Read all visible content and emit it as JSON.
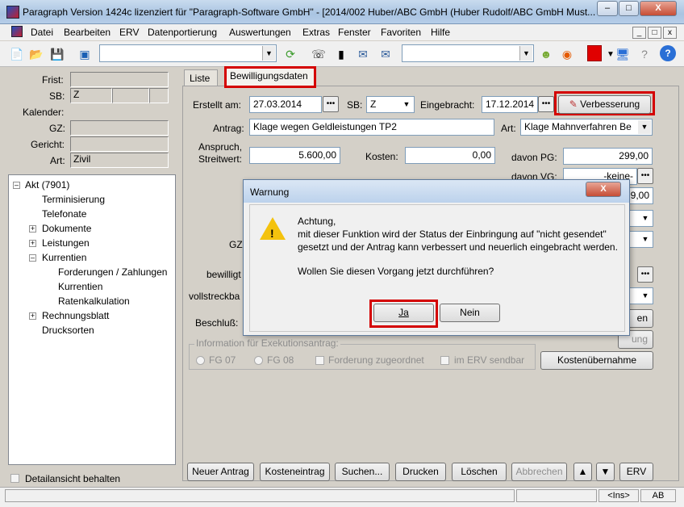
{
  "window": {
    "title": "Paragraph Version 1424c lizenziert für \"Paragraph-Software GmbH\" - [2014/002 Huber/ABC GmbH (Huber Rudolf/ABC GmbH Must...",
    "min": "–",
    "max": "□",
    "close": "X"
  },
  "menu": [
    "Datei",
    "Bearbeiten",
    "ERV",
    "Datenportierung",
    "Auswertungen",
    "Extras",
    "Fenster",
    "Favoriten",
    "Hilfe"
  ],
  "mdi": {
    "min": "_",
    "restore": "□",
    "close": "x"
  },
  "left": {
    "frist_label": "Frist:",
    "sb_label": "SB:",
    "sb_value": "Z",
    "kalender_label": "Kalender:",
    "gz_label": "GZ:",
    "gericht_label": "Gericht:",
    "art_label": "Art:",
    "art_value": "Zivil",
    "detail_checkbox": "Detailansicht behalten"
  },
  "tree": [
    {
      "label": "Akt (7901)"
    },
    {
      "label": "Terminisierung"
    },
    {
      "label": "Telefonate"
    },
    {
      "label": "Dokumente"
    },
    {
      "label": "Leistungen"
    },
    {
      "label": "Kurrentien"
    },
    {
      "label": "Forderungen / Zahlungen"
    },
    {
      "label": "Kurrentien"
    },
    {
      "label": "Ratenkalkulation"
    },
    {
      "label": "Rechnungsblatt"
    },
    {
      "label": "Drucksorten"
    }
  ],
  "tabs": {
    "liste": "Liste",
    "bewilligung": "Bewilligungsdaten"
  },
  "form": {
    "erstellt_label": "Erstellt am:",
    "erstellt_value": "27.03.2014",
    "sb_label": "SB:",
    "sb_value": "Z",
    "eingebracht_label": "Eingebracht:",
    "eingebracht_value": "17.12.2014",
    "verbesserung_button": "Verbesserung",
    "antrag_label": "Antrag:",
    "antrag_value": "Klage wegen Geldleistungen TP2",
    "art_label": "Art:",
    "art_value": "Klage Mahnverfahren Be",
    "anspruch_label_1": "Anspruch,",
    "anspruch_label_2": "Streitwert:",
    "anspruch_value": "5.600,00",
    "kosten_label": "Kosten:",
    "kosten_value": "0,00",
    "davon_pg_label": "davon PG:",
    "davon_pg_value": "299,00",
    "davon_vg_label": "davon VG:",
    "davon_vg_value": "-keine-",
    "hidden_value": "9,00",
    "gz_label": "GZ",
    "bewilligt_label": "bewilligt",
    "vollstreckbar_label": "vollstreckba",
    "beschluss_label": "Beschluß:",
    "right_btn1": "en",
    "right_btn2": "ung",
    "info_group": "Information für Exekutionsantrag:",
    "fg07": "FG 07",
    "fg08": "FG 08",
    "forderung_zugeordnet": "Forderung zugeordnet",
    "im_erv_sendbar": "im ERV sendbar",
    "kostenuebernahme": "Kostenübernahme"
  },
  "bottom_buttons": {
    "neuer_antrag": "Neuer Antrag",
    "kosteneintrag": "Kosteneintrag",
    "suchen": "Suchen...",
    "drucken": "Drucken",
    "loeschen": "Löschen",
    "abbrechen": "Abbrechen",
    "up": "▲",
    "down": "▼",
    "erv": "ERV"
  },
  "dialog": {
    "title": "Warnung",
    "line1": "Achtung,",
    "line2": "mit dieser Funktion wird der Status der Einbringung auf \"nicht gesendet\"",
    "line3": "gesetzt und der Antrag kann verbessert und neuerlich eingebracht werden.",
    "question": "Wollen Sie diesen Vorgang jetzt durchführen?",
    "ja": "Ja",
    "nein": "Nein",
    "close": "X"
  },
  "status": {
    "ins": "<Ins>",
    "ab": "AB"
  },
  "colors": {
    "highlight": "#d40000"
  }
}
